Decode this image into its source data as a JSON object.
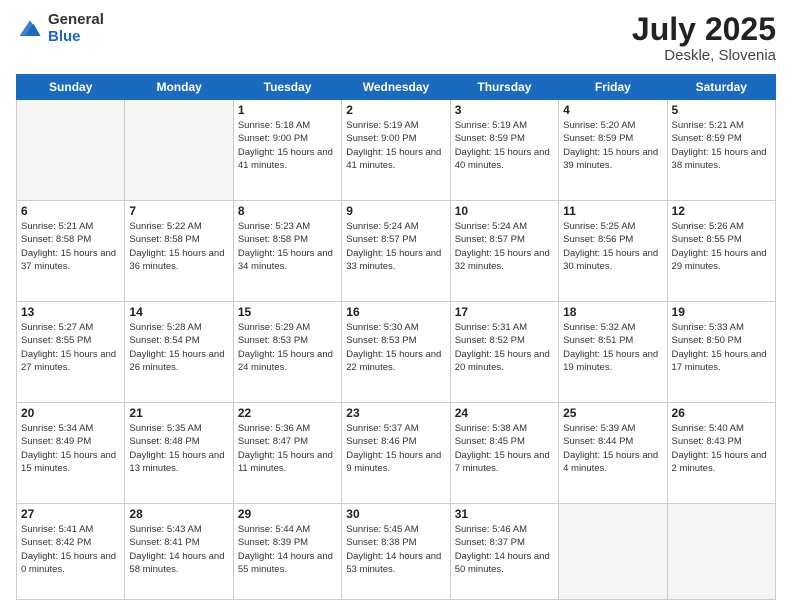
{
  "logo": {
    "general": "General",
    "blue": "Blue"
  },
  "title": {
    "month": "July 2025",
    "location": "Deskle, Slovenia"
  },
  "weekdays": [
    "Sunday",
    "Monday",
    "Tuesday",
    "Wednesday",
    "Thursday",
    "Friday",
    "Saturday"
  ],
  "weeks": [
    [
      {
        "day": "",
        "info": ""
      },
      {
        "day": "",
        "info": ""
      },
      {
        "day": "1",
        "info": "Sunrise: 5:18 AM\nSunset: 9:00 PM\nDaylight: 15 hours and 41 minutes."
      },
      {
        "day": "2",
        "info": "Sunrise: 5:19 AM\nSunset: 9:00 PM\nDaylight: 15 hours and 41 minutes."
      },
      {
        "day": "3",
        "info": "Sunrise: 5:19 AM\nSunset: 8:59 PM\nDaylight: 15 hours and 40 minutes."
      },
      {
        "day": "4",
        "info": "Sunrise: 5:20 AM\nSunset: 8:59 PM\nDaylight: 15 hours and 39 minutes."
      },
      {
        "day": "5",
        "info": "Sunrise: 5:21 AM\nSunset: 8:59 PM\nDaylight: 15 hours and 38 minutes."
      }
    ],
    [
      {
        "day": "6",
        "info": "Sunrise: 5:21 AM\nSunset: 8:58 PM\nDaylight: 15 hours and 37 minutes."
      },
      {
        "day": "7",
        "info": "Sunrise: 5:22 AM\nSunset: 8:58 PM\nDaylight: 15 hours and 36 minutes."
      },
      {
        "day": "8",
        "info": "Sunrise: 5:23 AM\nSunset: 8:58 PM\nDaylight: 15 hours and 34 minutes."
      },
      {
        "day": "9",
        "info": "Sunrise: 5:24 AM\nSunset: 8:57 PM\nDaylight: 15 hours and 33 minutes."
      },
      {
        "day": "10",
        "info": "Sunrise: 5:24 AM\nSunset: 8:57 PM\nDaylight: 15 hours and 32 minutes."
      },
      {
        "day": "11",
        "info": "Sunrise: 5:25 AM\nSunset: 8:56 PM\nDaylight: 15 hours and 30 minutes."
      },
      {
        "day": "12",
        "info": "Sunrise: 5:26 AM\nSunset: 8:55 PM\nDaylight: 15 hours and 29 minutes."
      }
    ],
    [
      {
        "day": "13",
        "info": "Sunrise: 5:27 AM\nSunset: 8:55 PM\nDaylight: 15 hours and 27 minutes."
      },
      {
        "day": "14",
        "info": "Sunrise: 5:28 AM\nSunset: 8:54 PM\nDaylight: 15 hours and 26 minutes."
      },
      {
        "day": "15",
        "info": "Sunrise: 5:29 AM\nSunset: 8:53 PM\nDaylight: 15 hours and 24 minutes."
      },
      {
        "day": "16",
        "info": "Sunrise: 5:30 AM\nSunset: 8:53 PM\nDaylight: 15 hours and 22 minutes."
      },
      {
        "day": "17",
        "info": "Sunrise: 5:31 AM\nSunset: 8:52 PM\nDaylight: 15 hours and 20 minutes."
      },
      {
        "day": "18",
        "info": "Sunrise: 5:32 AM\nSunset: 8:51 PM\nDaylight: 15 hours and 19 minutes."
      },
      {
        "day": "19",
        "info": "Sunrise: 5:33 AM\nSunset: 8:50 PM\nDaylight: 15 hours and 17 minutes."
      }
    ],
    [
      {
        "day": "20",
        "info": "Sunrise: 5:34 AM\nSunset: 8:49 PM\nDaylight: 15 hours and 15 minutes."
      },
      {
        "day": "21",
        "info": "Sunrise: 5:35 AM\nSunset: 8:48 PM\nDaylight: 15 hours and 13 minutes."
      },
      {
        "day": "22",
        "info": "Sunrise: 5:36 AM\nSunset: 8:47 PM\nDaylight: 15 hours and 11 minutes."
      },
      {
        "day": "23",
        "info": "Sunrise: 5:37 AM\nSunset: 8:46 PM\nDaylight: 15 hours and 9 minutes."
      },
      {
        "day": "24",
        "info": "Sunrise: 5:38 AM\nSunset: 8:45 PM\nDaylight: 15 hours and 7 minutes."
      },
      {
        "day": "25",
        "info": "Sunrise: 5:39 AM\nSunset: 8:44 PM\nDaylight: 15 hours and 4 minutes."
      },
      {
        "day": "26",
        "info": "Sunrise: 5:40 AM\nSunset: 8:43 PM\nDaylight: 15 hours and 2 minutes."
      }
    ],
    [
      {
        "day": "27",
        "info": "Sunrise: 5:41 AM\nSunset: 8:42 PM\nDaylight: 15 hours and 0 minutes."
      },
      {
        "day": "28",
        "info": "Sunrise: 5:43 AM\nSunset: 8:41 PM\nDaylight: 14 hours and 58 minutes."
      },
      {
        "day": "29",
        "info": "Sunrise: 5:44 AM\nSunset: 8:39 PM\nDaylight: 14 hours and 55 minutes."
      },
      {
        "day": "30",
        "info": "Sunrise: 5:45 AM\nSunset: 8:38 PM\nDaylight: 14 hours and 53 minutes."
      },
      {
        "day": "31",
        "info": "Sunrise: 5:46 AM\nSunset: 8:37 PM\nDaylight: 14 hours and 50 minutes."
      },
      {
        "day": "",
        "info": ""
      },
      {
        "day": "",
        "info": ""
      }
    ]
  ]
}
